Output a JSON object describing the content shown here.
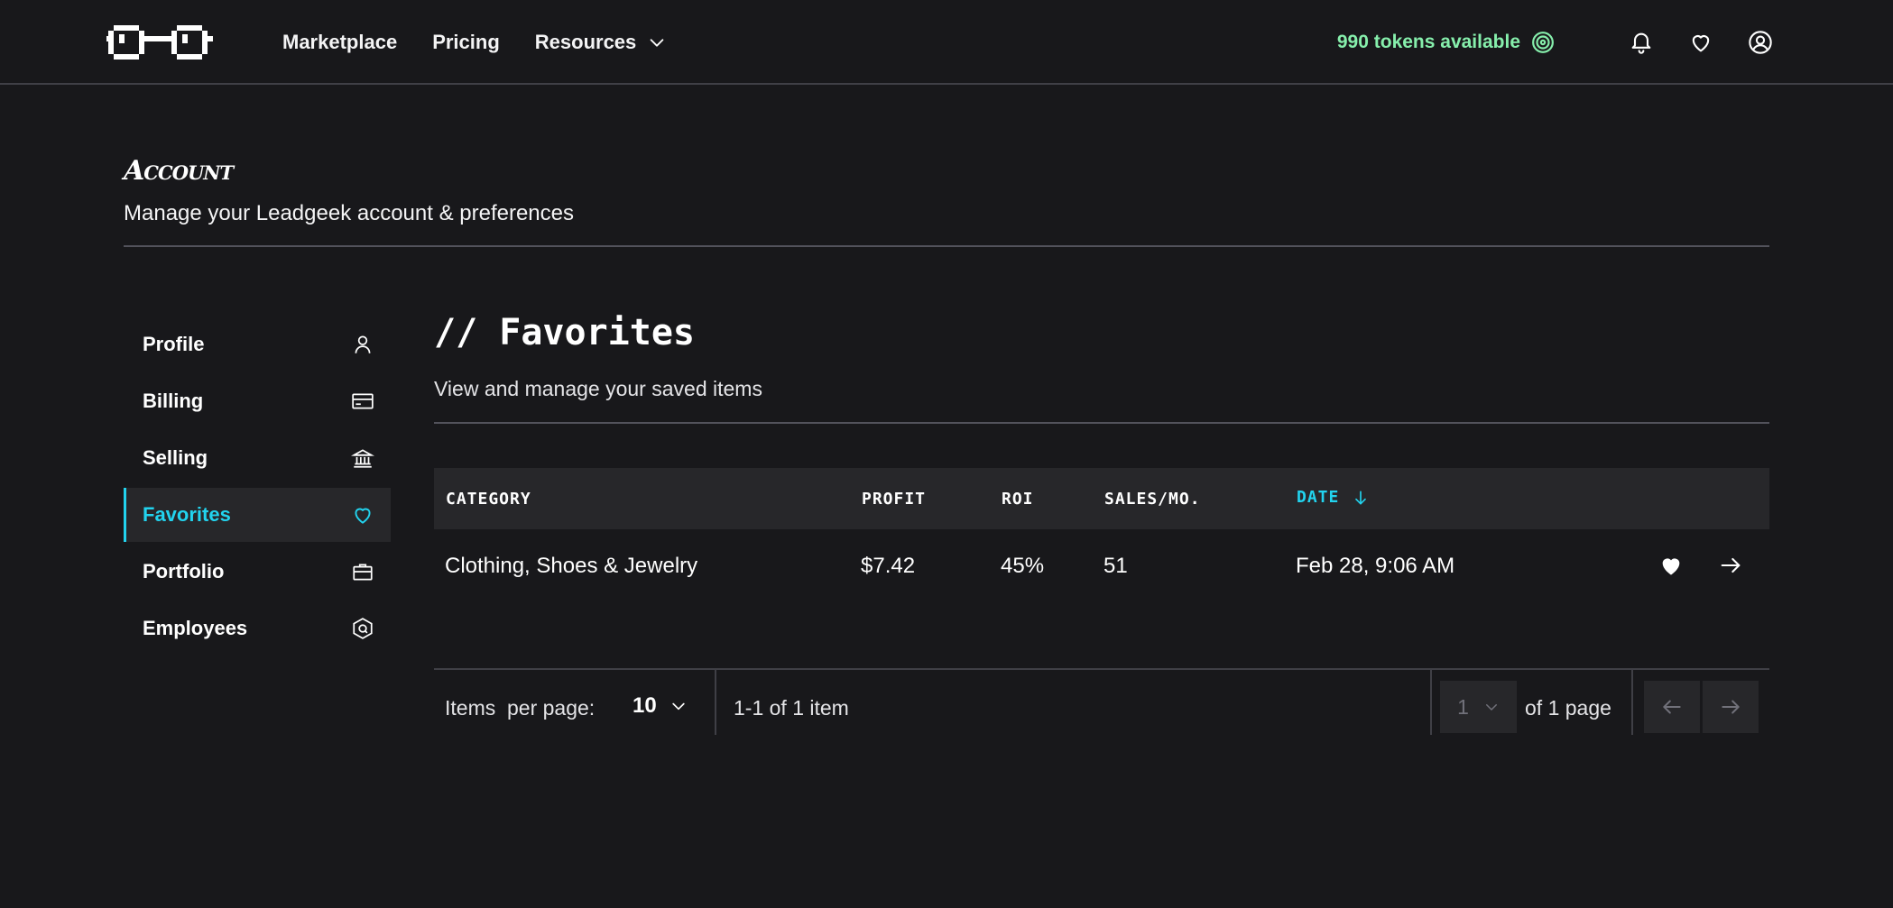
{
  "header": {
    "nav": [
      {
        "label": "Marketplace"
      },
      {
        "label": "Pricing"
      },
      {
        "label": "Resources"
      }
    ],
    "tokens_label": "990 tokens available"
  },
  "account": {
    "title": "Account",
    "subtitle": "Manage your Leadgeek account & preferences"
  },
  "sidebar": {
    "items": [
      {
        "label": "Profile",
        "icon": "user-icon"
      },
      {
        "label": "Billing",
        "icon": "credit-card-icon"
      },
      {
        "label": "Selling",
        "icon": "bank-icon"
      },
      {
        "label": "Favorites",
        "icon": "heart-icon",
        "active": true
      },
      {
        "label": "Portfolio",
        "icon": "briefcase-icon"
      },
      {
        "label": "Employees",
        "icon": "hexagon-icon"
      }
    ]
  },
  "content": {
    "title": "// Favorites",
    "subtitle": "View and manage your saved items"
  },
  "table": {
    "columns": [
      "CATEGORY",
      "PROFIT",
      "ROI",
      "SALES/MO.",
      "DATE"
    ],
    "sorted_column": "DATE",
    "rows": [
      {
        "category": "Clothing, Shoes & Jewelry",
        "profit": "$7.42",
        "roi": "45%",
        "sales": "51",
        "date": "Feb 28, 9:06 AM"
      }
    ]
  },
  "pagination": {
    "items_per_page_label": "Items  per page:",
    "items_per_page_value": "10",
    "range_label": "1-1 of 1 item",
    "current_page": "1",
    "of_pages_label": "of 1 page"
  },
  "colors": {
    "background": "#18181b",
    "accent": "#22d3ee",
    "tokens": "#86efac",
    "panel": "#27272a"
  }
}
